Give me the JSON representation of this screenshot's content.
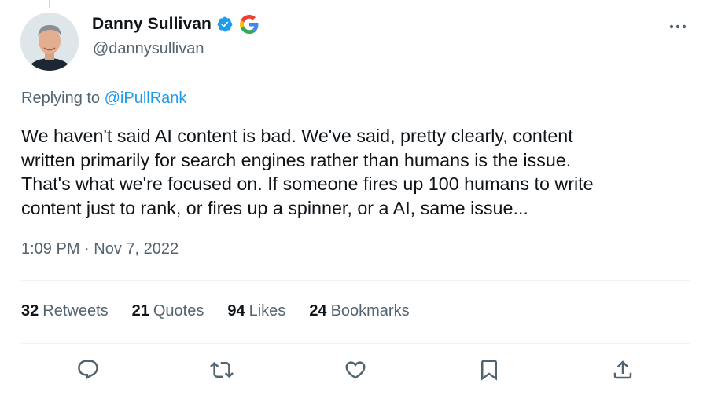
{
  "author": {
    "display_name": "Danny Sullivan",
    "handle": "@dannysullivan",
    "verified": true,
    "affiliation_icon": "google-icon"
  },
  "reply": {
    "prefix": "Replying to ",
    "mention": "@iPullRank"
  },
  "tweet": {
    "text": "We haven't said AI content is bad. We've said, pretty clearly, content\nwritten primarily for search engines rather than humans is the issue.\nThat's what we're focused on. If someone fires up 100 humans to write\ncontent just to rank, or fires up a spinner, or a AI, same issue...",
    "timestamp": "1:09 PM · Nov 7, 2022"
  },
  "stats": {
    "retweets_count": "32",
    "retweets_label": "Retweets",
    "quotes_count": "21",
    "quotes_label": "Quotes",
    "likes_count": "94",
    "likes_label": "Likes",
    "bookmarks_count": "24",
    "bookmarks_label": "Bookmarks"
  },
  "actions": [
    "reply-icon",
    "retweet-icon",
    "like-icon",
    "bookmark-icon",
    "share-icon"
  ],
  "colors": {
    "accent": "#1d9bf0",
    "text_primary": "#0f1419",
    "text_secondary": "#536471",
    "divider": "#eff3f4"
  }
}
